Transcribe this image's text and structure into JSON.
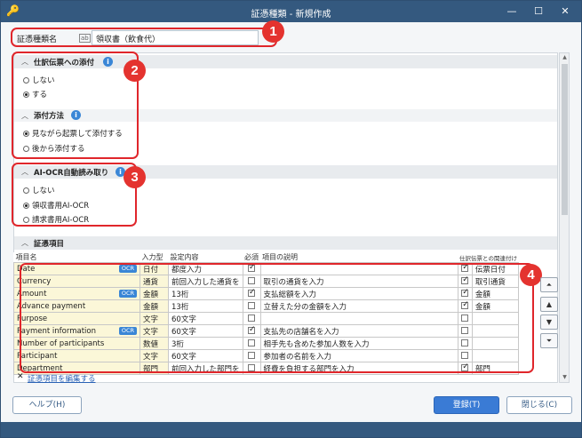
{
  "window": {
    "title": "証憑種類 - 新規作成",
    "minimize": "—",
    "maximize": "☐",
    "close": "✕"
  },
  "name_row": {
    "label": "証憑種類名",
    "kb_icon": "⌨",
    "value": "領収書（飲食代）"
  },
  "attach": {
    "title": "仕訳伝票への添付",
    "options": [
      {
        "label": "しない",
        "selected": false
      },
      {
        "label": "する",
        "selected": true
      }
    ]
  },
  "attach_method": {
    "title": "添付方法",
    "options": [
      {
        "label": "見ながら起票して添付する",
        "selected": true
      },
      {
        "label": "後から添付する",
        "selected": false
      }
    ]
  },
  "aiocr": {
    "title": "AI-OCR自動読み取り",
    "options": [
      {
        "label": "しない",
        "selected": false
      },
      {
        "label": "領収書用AI-OCR",
        "selected": true
      },
      {
        "label": "請求書用AI-OCR",
        "selected": false
      }
    ]
  },
  "items": {
    "title": "証憑項目",
    "columns": [
      "項目名",
      "入力型",
      "設定内容",
      "必須",
      "項目の説明",
      "仕訳伝票との関連付け"
    ],
    "rows": [
      {
        "name": "Date",
        "ocr": true,
        "type": "日付",
        "setting": "都度入力",
        "required": true,
        "desc": "",
        "link": true,
        "link_label": "伝票日付"
      },
      {
        "name": "Currency",
        "ocr": false,
        "type": "通貨",
        "setting": "前回入力した通貨を",
        "required": false,
        "desc": "取引の通貨を入力",
        "link": true,
        "link_label": "取引通貨"
      },
      {
        "name": "Amount",
        "ocr": true,
        "type": "金額",
        "setting": "13桁",
        "required": true,
        "desc": "支払総額を入力",
        "link": true,
        "link_label": "金額"
      },
      {
        "name": "Advance payment",
        "ocr": false,
        "type": "金額",
        "setting": "13桁",
        "required": false,
        "desc": "立替えた分の金額を入力",
        "link": true,
        "link_label": "金額"
      },
      {
        "name": "Purpose",
        "ocr": false,
        "type": "文字",
        "setting": "60文字",
        "required": false,
        "desc": "",
        "link": false,
        "link_label": ""
      },
      {
        "name": "Payment information",
        "ocr": true,
        "type": "文字",
        "setting": "60文字",
        "required": true,
        "desc": "支払先の店舗名を入力",
        "link": false,
        "link_label": ""
      },
      {
        "name": "Number of participants",
        "ocr": false,
        "type": "数値",
        "setting": "3桁",
        "required": false,
        "desc": "相手先も含めた参加人数を入力",
        "link": false,
        "link_label": ""
      },
      {
        "name": "Participant",
        "ocr": false,
        "type": "文字",
        "setting": "60文字",
        "required": false,
        "desc": "参加者の名前を入力",
        "link": false,
        "link_label": ""
      },
      {
        "name": "Department",
        "ocr": false,
        "type": "部門",
        "setting": "前回入力した部門を",
        "required": false,
        "desc": "経費を負担する部門を入力",
        "link": true,
        "link_label": "部門"
      }
    ],
    "ocr_badge": "OCR",
    "edit_link": "証憑項目を編集する"
  },
  "callouts": [
    "1",
    "2",
    "3",
    "4"
  ],
  "buttons": {
    "help": "ヘルプ(H)",
    "register": "登録(T)",
    "close": "閉じる(C)"
  },
  "colors": {
    "titlebar": "#34597f",
    "callout": "#e0262b",
    "info": "#3a86d6",
    "primary": "#3a7bd5"
  }
}
